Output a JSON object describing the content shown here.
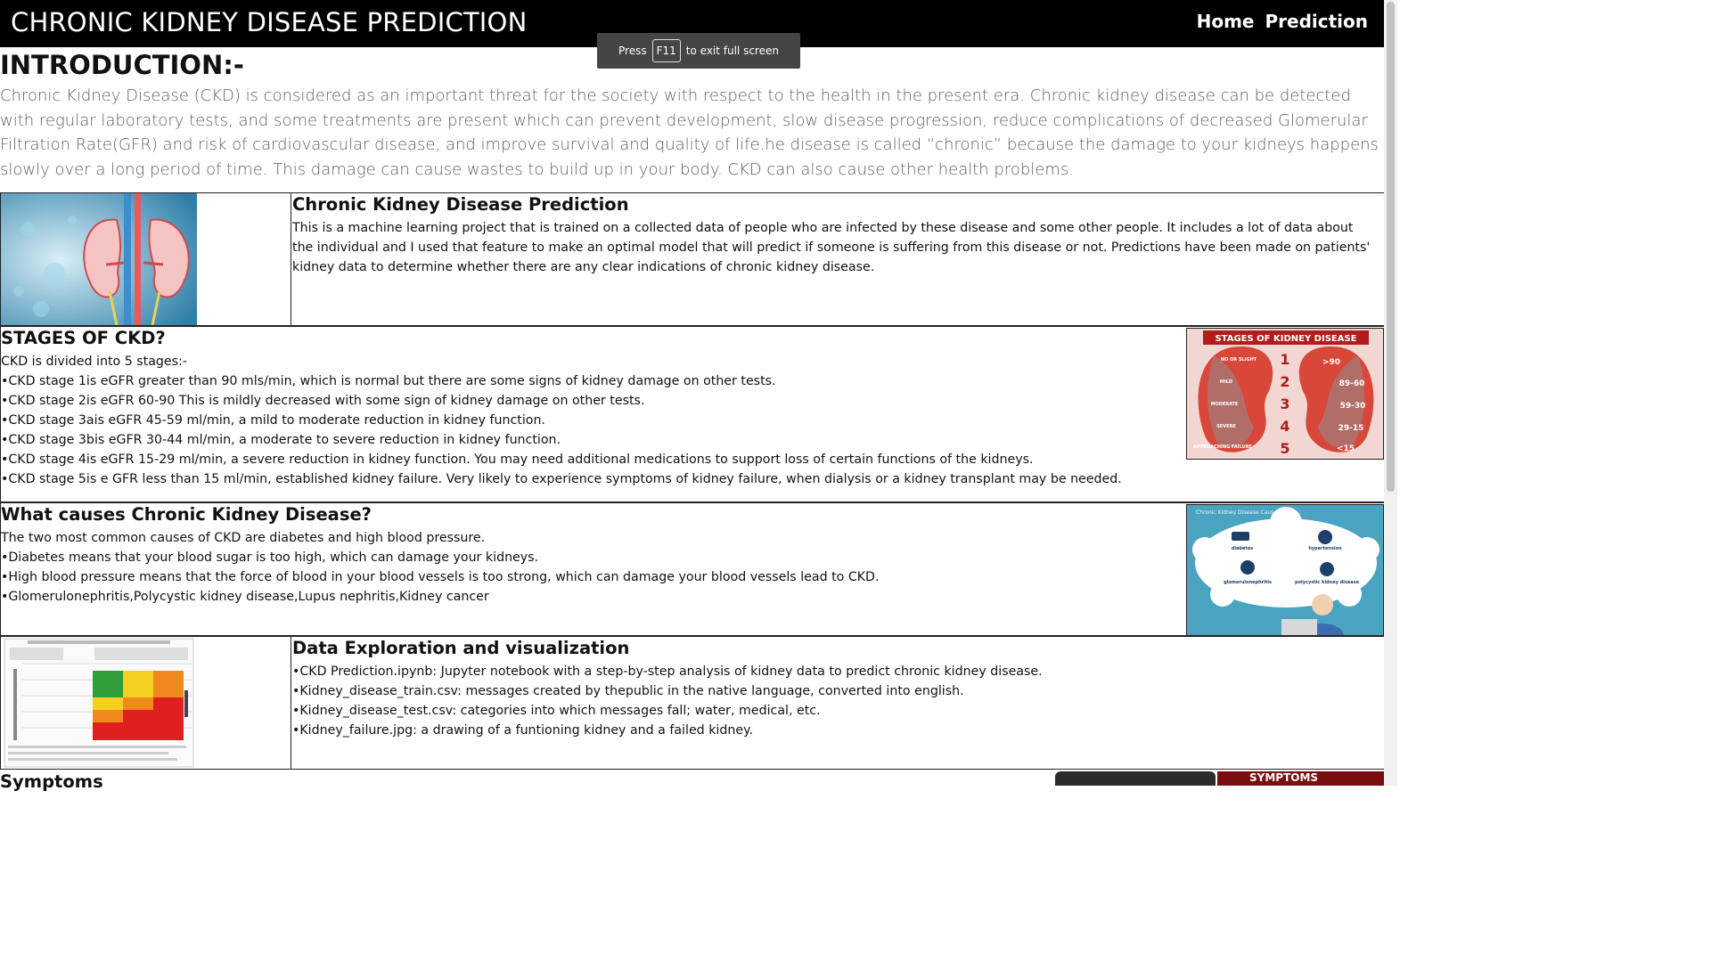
{
  "navbar": {
    "brand": "CHRONIC KIDNEY DISEASE PREDICTION",
    "links": [
      "Home",
      "Prediction"
    ]
  },
  "fullscreen_toast": {
    "before": "Press",
    "key": "F11",
    "after": "to exit full screen"
  },
  "intro": {
    "heading": "INTRODUCTION:-",
    "text": "Chronic Kidney Disease (CKD) is considered as an important threat for the society with respect to the health in the present era. Chronic kidney disease can be detected with regular laboratory tests, and some treatments are present which can prevent development, slow disease progression, reduce complications of decreased Glomerular Filtration Rate(GFR) and risk of cardiovascular disease, and improve survival and quality of life.he disease is called “chronic” because the damage to your kidneys happens slowly over a long period of time. This damage can cause wastes to build up in your body. CKD can also cause other health problems."
  },
  "sections": [
    {
      "title": "Chronic Kidney Disease Prediction",
      "paragraphs": [
        "This is a machine learning project that is trained on a collected data of people who are infected by these disease and some other people. It includes a lot of data about the individual and I used that feature to make an optimal model that will predict if someone is suffering from this disease or not. Predictions have been made on patients' kidney data to determine whether there are any clear indications of chronic kidney disease."
      ]
    },
    {
      "title": "STAGES OF CKD?",
      "paragraphs": [
        "CKD is divided into 5 stages:-",
        "•CKD stage 1is eGFR greater than 90 mls/min, which is normal but there are some signs of kidney damage on other tests.",
        "•CKD stage 2is eGFR 60-90 This is mildly decreased with some sign of kidney damage on other tests.",
        "•CKD stage 3ais eGFR 45-59 ml/min, a mild to moderate reduction in kidney function.",
        "•CKD stage 3bis eGFR 30-44 ml/min, a moderate to severe reduction in kidney function.",
        "•CKD stage 4is eGFR 15-29 ml/min, a severe reduction in kidney function. You may need additional medications to support loss of certain functions of the kidneys.",
        "•CKD stage 5is e GFR less than 15 ml/min, established kidney failure. Very likely to experience symptoms of kidney failure, when dialysis or a kidney transplant may be needed."
      ],
      "image": {
        "title": "STAGES OF KIDNEY DISEASE",
        "left_labels": [
          "NO OR SLIGHT",
          "MILD",
          "MODERATE",
          "SEVERE",
          "APPROACHING FAILURE"
        ],
        "numbers": [
          "1",
          "2",
          "3",
          "4",
          "5"
        ],
        "right_labels": [
          ">90",
          "89-60",
          "59-30",
          "29-15",
          "<15"
        ]
      }
    },
    {
      "title": "What causes Chronic Kidney Disease?",
      "paragraphs": [
        "The two most common causes of CKD are diabetes and high blood pressure.",
        "•Diabetes means that your blood sugar is too high, which can damage your kidneys.",
        "•High blood pressure means that the force of blood in your blood vessels is too strong, which can damage your blood vessels lead to CKD.",
        "•Glomerulonephritis,Polycystic kidney disease,Lupus nephritis,Kidney cancer"
      ],
      "image": {
        "title": "Chronic Kidney Disease Causes",
        "causes": [
          "diabetes",
          "hypertension",
          "glomerulonephritis",
          "polycystic kidney disease"
        ]
      }
    },
    {
      "title": "Data Exploration and visualization",
      "paragraphs": [
        "•CKD Prediction.ipynb: Jupyter notebook with a step-by-step analysis of kidney data to predict chronic kidney disease.",
        "•Kidney_disease_train.csv: messages created by thepublic in the native language, converted into english.",
        "•Kidney_disease_test.csv: categories into which messages fall; water, medical, etc.",
        "•Kidney_failure.jpg: a drawing of a funtioning kidney and a failed kidney."
      ]
    }
  ],
  "next_section": {
    "title": "Symptoms",
    "image_text": "SYMPTOMS"
  },
  "colors": {
    "navbar": "#000000",
    "intro_text": "#5f5f5f",
    "stage_red": "#e2463a"
  }
}
